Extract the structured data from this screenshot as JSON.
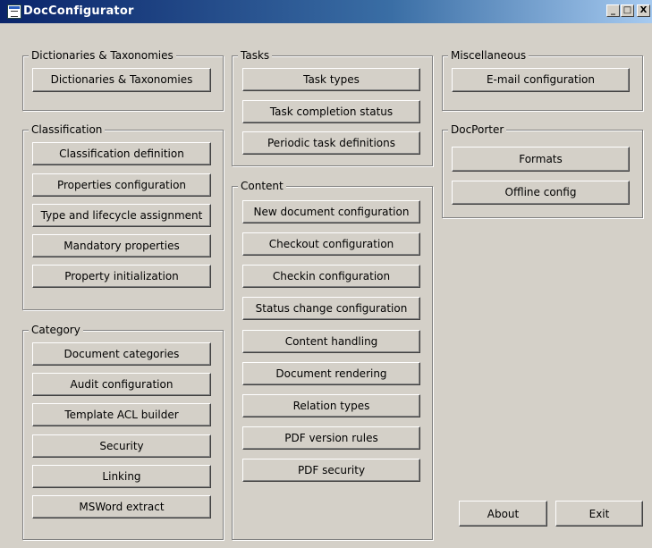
{
  "window": {
    "title": "DocConfigurator",
    "controls": {
      "minimize": "_",
      "maximize": "□",
      "close": "X"
    }
  },
  "groups": {
    "dictionaries": {
      "label": "Dictionaries & Taxonomies",
      "buttons": [
        "Dictionaries & Taxonomies"
      ]
    },
    "classification": {
      "label": "Classification",
      "buttons": [
        "Classification definition",
        "Properties configuration",
        "Type and lifecycle assignment",
        "Mandatory properties",
        "Property initialization"
      ]
    },
    "category": {
      "label": "Category",
      "buttons": [
        "Document categories",
        "Audit configuration",
        "Template ACL builder",
        "Security",
        "Linking",
        "MSWord extract"
      ]
    },
    "tasks": {
      "label": "Tasks",
      "buttons": [
        "Task types",
        "Task completion status",
        "Periodic task definitions"
      ]
    },
    "content": {
      "label": "Content",
      "buttons": [
        "New document configuration",
        "Checkout configuration",
        "Checkin configuration",
        "Status change configuration",
        "Content handling",
        "Document rendering",
        "Relation types",
        "PDF version rules",
        "PDF security"
      ]
    },
    "miscellaneous": {
      "label": "Miscellaneous",
      "buttons": [
        "E-mail configuration"
      ]
    },
    "docporter": {
      "label": "DocPorter",
      "buttons": [
        "Formats",
        "Offline config"
      ]
    }
  },
  "footer": {
    "about": "About",
    "exit": "Exit"
  }
}
